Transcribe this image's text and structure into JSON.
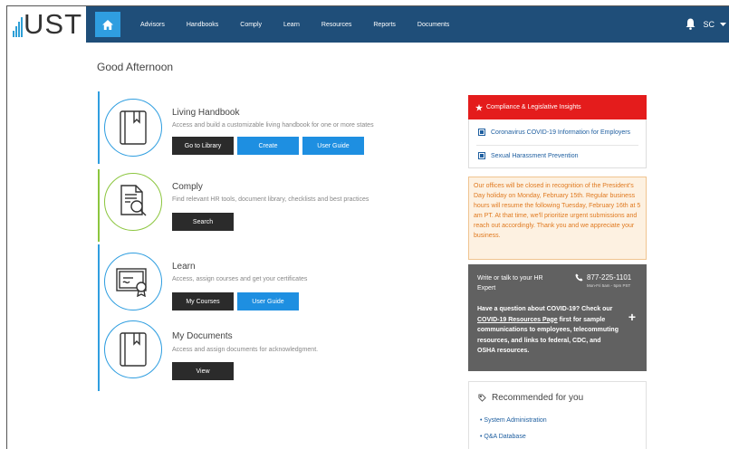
{
  "logo": {
    "text": "UST"
  },
  "nav": {
    "items": [
      "Advisors",
      "Handbooks",
      "Comply",
      "Learn",
      "Resources",
      "Reports",
      "Documents"
    ],
    "user_initials": "SC"
  },
  "greeting": "Good Afternoon",
  "sections": {
    "handbook": {
      "title": "Living Handbook",
      "desc": "Access and build a customizable living handbook for one or more states",
      "btn1": "Go to Library",
      "btn2": "Create",
      "btn3": "User Guide"
    },
    "comply": {
      "title": "Comply",
      "desc": "Find relevant HR tools, document library, checklists and best practices",
      "btn1": "Search"
    },
    "learn": {
      "title": "Learn",
      "desc": "Access, assign courses and get your certificates",
      "btn1": "My Courses",
      "btn2": "User Guide"
    },
    "documents": {
      "title": "My Documents",
      "desc": "Access and assign documents for acknowledgment.",
      "btn1": "View"
    }
  },
  "compliance": {
    "title": "Compliance & Legislative Insights",
    "links": [
      "Coronavirus COVID-19 Information for Employers",
      "Sexual Harassment Prevention"
    ]
  },
  "notice": "Our offices will be closed in recognition of the President's Day holiday on Monday, February 15th. Regular business hours will resume the following Tuesday, February 16th at 5 am PT. At that time, we'll prioritize urgent submissions and reach out accordingly. Thank you and we appreciate your business.",
  "expert": {
    "label": "Write or talk to your HR Expert",
    "phone": "877-225-1101",
    "hours": "Mon-Fri 5am - 5pm PST",
    "msg_pre": "Have a question about COVID-19? Check our",
    "msg_link": "COVID-19 Resources Page",
    "msg_post": "first for sample communications to employees, telecommuting resources, and links to federal, CDC, and OSHA resources."
  },
  "recommended": {
    "title": "Recommended for you",
    "items": [
      "System Administration",
      "Q&A Database"
    ]
  },
  "colors": {
    "nav": "#1f4e79",
    "accent": "#2f9ee0",
    "red": "#e41c1c",
    "green": "#8cc63f"
  }
}
